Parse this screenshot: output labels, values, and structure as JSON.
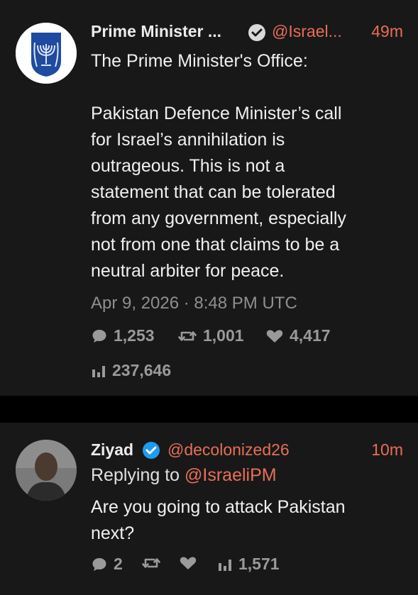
{
  "tweet1": {
    "name": "Prime Minister ...",
    "handle": "@Israel...",
    "time": "49m",
    "line0": "The Prime Minister's Office:",
    "body": [
      "Pakistan Defence Minister’s call",
      "for Israel’s annihilation is",
      "outrageous. This is not a",
      "statement that can be tolerated",
      "from any government, especially",
      "not from one that claims to be a",
      "neutral arbiter for peace."
    ],
    "date": "Apr 9, 2026 · 8:48 PM UTC",
    "replies": "1,253",
    "retweets": "1,001",
    "likes": "4,417",
    "views": "237,646"
  },
  "tweet2": {
    "name": "Ziyad",
    "handle": "@decolonized26",
    "time": "10m",
    "replying_prefix": "Replying to",
    "replying_handle": "@IsraeliPM",
    "body": [
      "Are you going to attack Pakistan",
      "next?"
    ],
    "replies": "2",
    "views": "1,571"
  },
  "colors": {
    "accent": "#e76e59",
    "verified": "#1d9bf0",
    "background": "#181818"
  }
}
